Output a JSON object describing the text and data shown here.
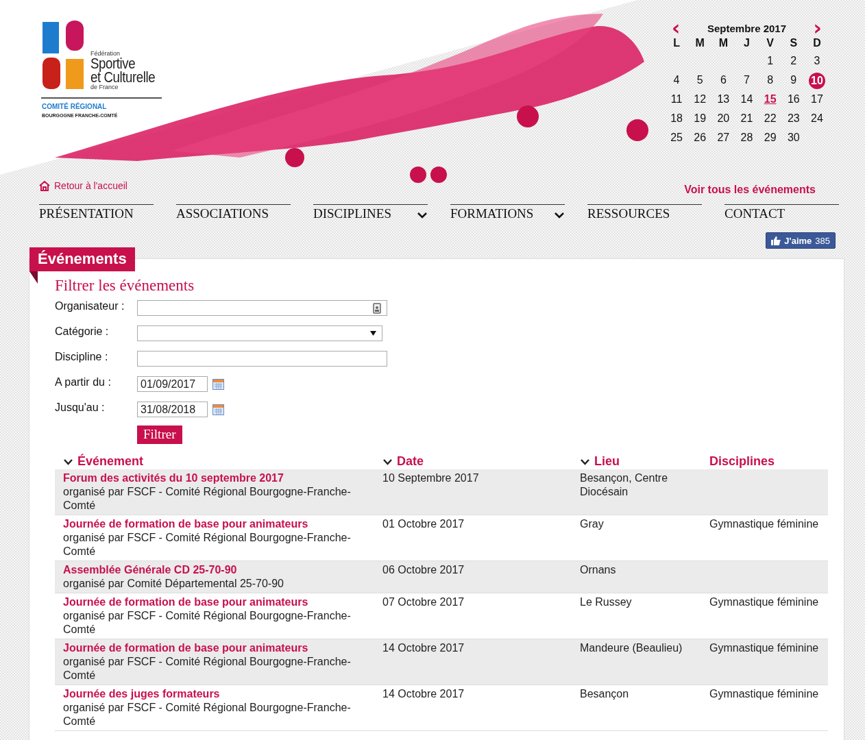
{
  "logo": {
    "small_top": "Fédération",
    "line1": "Sportive",
    "line2": "et Culturelle",
    "small_bottom": "de France",
    "committee": "COMITÉ RÉGIONAL",
    "region": "BOURGOGNE FRANCHE-COMTÉ"
  },
  "home_link": "Retour à l'accueil",
  "calendar": {
    "prev": "‹",
    "next": "›",
    "month": "Septembre 2017",
    "weekdays": [
      "L",
      "M",
      "M",
      "J",
      "V",
      "S",
      "D"
    ],
    "weeks": [
      [
        {
          "day": "1",
          "kind": "plain"
        },
        {
          "day": "2",
          "kind": "plain"
        },
        {
          "day": "3",
          "kind": "plain"
        }
      ],
      [
        {
          "day": "4",
          "kind": "plain"
        },
        {
          "day": "5",
          "kind": "plain"
        },
        {
          "day": "6",
          "kind": "plain"
        },
        {
          "day": "7",
          "kind": "plain"
        },
        {
          "day": "8",
          "kind": "plain"
        },
        {
          "day": "9",
          "kind": "plain"
        },
        {
          "day": "10",
          "kind": "today"
        }
      ],
      [
        {
          "day": "11",
          "kind": "plain"
        },
        {
          "day": "12",
          "kind": "plain"
        },
        {
          "day": "13",
          "kind": "plain"
        },
        {
          "day": "14",
          "kind": "plain"
        },
        {
          "day": "15",
          "kind": "event"
        },
        {
          "day": "16",
          "kind": "plain"
        },
        {
          "day": "17",
          "kind": "plain"
        }
      ],
      [
        {
          "day": "18",
          "kind": "plain"
        },
        {
          "day": "19",
          "kind": "plain"
        },
        {
          "day": "20",
          "kind": "plain"
        },
        {
          "day": "21",
          "kind": "plain"
        },
        {
          "day": "22",
          "kind": "plain"
        },
        {
          "day": "23",
          "kind": "plain"
        },
        {
          "day": "24",
          "kind": "plain"
        }
      ],
      [
        {
          "day": "25",
          "kind": "plain"
        },
        {
          "day": "26",
          "kind": "plain"
        },
        {
          "day": "27",
          "kind": "plain"
        },
        {
          "day": "28",
          "kind": "plain"
        },
        {
          "day": "29",
          "kind": "plain"
        },
        {
          "day": "30",
          "kind": "plain"
        }
      ]
    ]
  },
  "all_events_link": "Voir tous les événements",
  "nav": [
    {
      "label": "PRÉSENTATION",
      "dropdown": false
    },
    {
      "label": "ASSOCIATIONS",
      "dropdown": false
    },
    {
      "label": "DISCIPLINES",
      "dropdown": true
    },
    {
      "label": "FORMATIONS",
      "dropdown": true
    },
    {
      "label": "RESSOURCES",
      "dropdown": false
    },
    {
      "label": "CONTACT",
      "dropdown": false
    }
  ],
  "like_button": {
    "label": "J'aime",
    "count": "385"
  },
  "section_tab": "Événements",
  "filter": {
    "title": "Filtrer les événements",
    "fields": [
      {
        "label": "Organisateur :",
        "kind": "contact"
      },
      {
        "label": "Catégorie :",
        "kind": "select"
      },
      {
        "label": "Discipline :",
        "kind": "text"
      },
      {
        "label": "A partir du :",
        "kind": "date",
        "value": "01/09/2017"
      },
      {
        "label": "Jusqu'au :",
        "kind": "date",
        "value": "31/08/2018"
      }
    ],
    "button": "Filtrer"
  },
  "table": {
    "columns": [
      {
        "label": "Événement",
        "sortable": true
      },
      {
        "label": "Date",
        "sortable": true
      },
      {
        "label": "Lieu",
        "sortable": true
      },
      {
        "label": "Disciplines",
        "sortable": false
      }
    ],
    "rows": [
      {
        "title": "Forum des activités du 10 septembre 2017",
        "organizer": "organisé par FSCF - Comité Régional Bourgogne-Franche-Comté",
        "date": "10 Septembre 2017",
        "place": "Besançon, Centre Diocésain"
      },
      {
        "title": "Journée de formation de base pour animateurs",
        "organizer": "organisé par FSCF - Comité Régional Bourgogne-Franche-Comté",
        "date": "01 Octobre 2017",
        "place": "Gray",
        "disciplines": "Gymnastique féminine"
      },
      {
        "title": "Assemblée Générale CD 25-70-90",
        "organizer": "organisé par Comité Départemental 25-70-90",
        "date": "06 Octobre 2017",
        "place": "Ornans"
      },
      {
        "title": "Journée de formation de base pour animateurs",
        "organizer": "organisé par FSCF - Comité Régional Bourgogne-Franche-Comté",
        "date": "07 Octobre 2017",
        "place": "Le Russey",
        "disciplines": "Gymnastique féminine"
      },
      {
        "title": "Journée de formation de base pour animateurs",
        "organizer": "organisé par FSCF - Comité Régional Bourgogne-Franche-Comté",
        "date": "14 Octobre 2017",
        "place": "Mandeure (Beaulieu)",
        "disciplines": "Gymnastique féminine"
      },
      {
        "title": "Journée des juges formateurs",
        "organizer": "organisé par FSCF - Comité Régional Bourgogne-Franche-Comté",
        "date": "14 Octobre 2017",
        "place": "Besançon",
        "disciplines": "Gymnastique féminine"
      }
    ]
  }
}
